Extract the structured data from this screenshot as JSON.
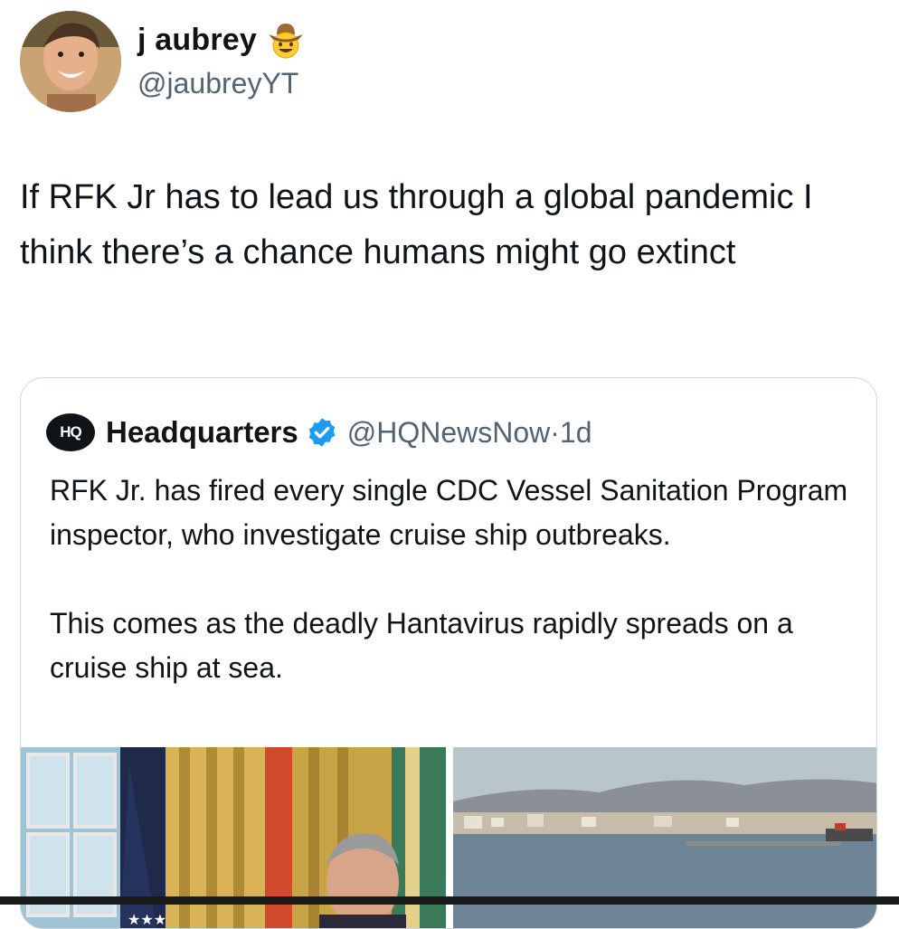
{
  "author": {
    "display_name": "j aubrey",
    "handle": "@jaubreyYT",
    "badge_icon": "cowboy-hat-face-emoji"
  },
  "tweet": {
    "text": "If RFK Jr has to lead us through a global pandemic I think there’s a chance humans might go extinct"
  },
  "quoted_tweet": {
    "logo_text": "HQ",
    "display_name": "Headquarters",
    "verified_icon": "verified-badge-icon",
    "handle": "@HQNewsNow",
    "separator": "·",
    "time": "1d",
    "paragraphs": [
      "RFK Jr. has fired every single CDC Vessel Sanitation Program inspector, who investigate cruise ship outbreaks.",
      "This comes as the deadly Hantavirus rapidly spreads on a cruise ship at sea."
    ],
    "media": [
      {
        "name": "rfk-jr-photo"
      },
      {
        "name": "coastal-port-photo"
      }
    ]
  },
  "colors": {
    "text": "#0f1419",
    "secondary": "#536471",
    "border": "#cfd9de",
    "verified": "#1d9bf0"
  }
}
